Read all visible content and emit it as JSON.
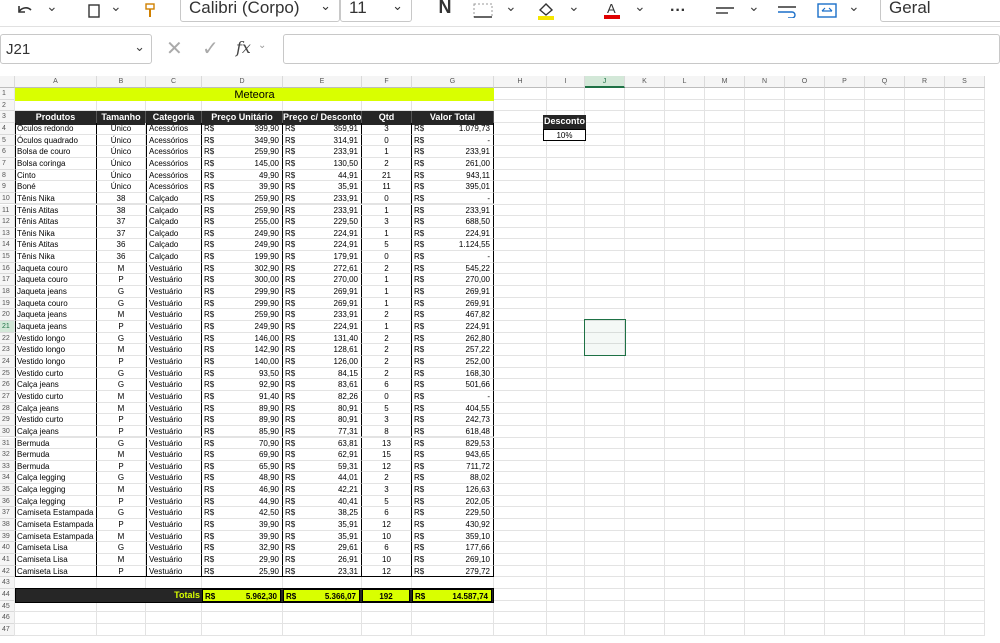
{
  "ribbon": {
    "font_name": "Calibri (Corpo)",
    "font_size": "11",
    "bold_glyph": "N",
    "number_format": "Geral",
    "more_glyph": "···",
    "fill_color": "#f5e600",
    "font_color": "#e00000"
  },
  "formula_bar": {
    "name_box": "J21",
    "fx_label": "fx",
    "formula": ""
  },
  "columns": [
    "A",
    "B",
    "C",
    "D",
    "E",
    "F",
    "G",
    "H",
    "I",
    "J",
    "K",
    "L",
    "M",
    "N",
    "O",
    "P",
    "Q",
    "R",
    "S"
  ],
  "title": "Meteora",
  "headers": [
    "Produtos",
    "Tamanho",
    "Categoria",
    "Preço Unitário",
    "Preço c/ Desconto",
    "Qtd",
    "Valor Total"
  ],
  "currency": "R$",
  "rows": [
    [
      "Óculos redondo",
      "Único",
      "Acessórios",
      "399,90",
      "359,91",
      "3",
      "1.079,73"
    ],
    [
      "Óculos quadrado",
      "Único",
      "Acessórios",
      "349,90",
      "314,91",
      "0",
      "-"
    ],
    [
      "Bolsa de couro",
      "Único",
      "Acessórios",
      "259,90",
      "233,91",
      "1",
      "233,91"
    ],
    [
      "Bolsa coringa",
      "Único",
      "Acessórios",
      "145,00",
      "130,50",
      "2",
      "261,00"
    ],
    [
      "Cinto",
      "Único",
      "Acessórios",
      "49,90",
      "44,91",
      "21",
      "943,11"
    ],
    [
      "Boné",
      "Único",
      "Acessórios",
      "39,90",
      "35,91",
      "11",
      "395,01"
    ],
    [
      "Tênis Nika",
      "38",
      "Calçado",
      "259,90",
      "233,91",
      "0",
      "-"
    ],
    [
      "Tênis Atitas",
      "38",
      "Calçado",
      "259,90",
      "233,91",
      "1",
      "233,91"
    ],
    [
      "Tênis Atitas",
      "37",
      "Calçado",
      "255,00",
      "229,50",
      "3",
      "688,50"
    ],
    [
      "Tênis Nika",
      "37",
      "Calçado",
      "249,90",
      "224,91",
      "1",
      "224,91"
    ],
    [
      "Tênis Atitas",
      "36",
      "Calçado",
      "249,90",
      "224,91",
      "5",
      "1.124,55"
    ],
    [
      "Tênis Nika",
      "36",
      "Calçado",
      "199,90",
      "179,91",
      "0",
      "-"
    ],
    [
      "Jaqueta couro",
      "M",
      "Vestuário",
      "302,90",
      "272,61",
      "2",
      "545,22"
    ],
    [
      "Jaqueta couro",
      "P",
      "Vestuário",
      "300,00",
      "270,00",
      "1",
      "270,00"
    ],
    [
      "Jaqueta jeans",
      "G",
      "Vestuário",
      "299,90",
      "269,91",
      "1",
      "269,91"
    ],
    [
      "Jaqueta couro",
      "G",
      "Vestuário",
      "299,90",
      "269,91",
      "1",
      "269,91"
    ],
    [
      "Jaqueta jeans",
      "M",
      "Vestuário",
      "259,90",
      "233,91",
      "2",
      "467,82"
    ],
    [
      "Jaqueta jeans",
      "P",
      "Vestuário",
      "249,90",
      "224,91",
      "1",
      "224,91"
    ],
    [
      "Vestido longo",
      "G",
      "Vestuário",
      "146,00",
      "131,40",
      "2",
      "262,80"
    ],
    [
      "Vestido longo",
      "M",
      "Vestuário",
      "142,90",
      "128,61",
      "2",
      "257,22"
    ],
    [
      "Vestido longo",
      "P",
      "Vestuário",
      "140,00",
      "126,00",
      "2",
      "252,00"
    ],
    [
      "Vestido curto",
      "G",
      "Vestuário",
      "93,50",
      "84,15",
      "2",
      "168,30"
    ],
    [
      "Calça jeans",
      "G",
      "Vestuário",
      "92,90",
      "83,61",
      "6",
      "501,66"
    ],
    [
      "Vestido curto",
      "M",
      "Vestuário",
      "91,40",
      "82,26",
      "0",
      "-"
    ],
    [
      "Calça jeans",
      "M",
      "Vestuário",
      "89,90",
      "80,91",
      "5",
      "404,55"
    ],
    [
      "Vestido curto",
      "P",
      "Vestuário",
      "89,90",
      "80,91",
      "3",
      "242,73"
    ],
    [
      "Calça jeans",
      "P",
      "Vestuário",
      "85,90",
      "77,31",
      "8",
      "618,48"
    ],
    [
      "Bermuda",
      "G",
      "Vestuário",
      "70,90",
      "63,81",
      "13",
      "829,53"
    ],
    [
      "Bermuda",
      "M",
      "Vestuário",
      "69,90",
      "62,91",
      "15",
      "943,65"
    ],
    [
      "Bermuda",
      "P",
      "Vestuário",
      "65,90",
      "59,31",
      "12",
      "711,72"
    ],
    [
      "Calça legging",
      "G",
      "Vestuário",
      "48,90",
      "44,01",
      "2",
      "88,02"
    ],
    [
      "Calça legging",
      "M",
      "Vestuário",
      "46,90",
      "42,21",
      "3",
      "126,63"
    ],
    [
      "Calça legging",
      "P",
      "Vestuário",
      "44,90",
      "40,41",
      "5",
      "202,05"
    ],
    [
      "Camiseta Estampada",
      "G",
      "Vestuário",
      "42,50",
      "38,25",
      "6",
      "229,50"
    ],
    [
      "Camiseta Estampada",
      "P",
      "Vestuário",
      "39,90",
      "35,91",
      "12",
      "430,92"
    ],
    [
      "Camiseta Estampada",
      "M",
      "Vestuário",
      "39,90",
      "35,91",
      "10",
      "359,10"
    ],
    [
      "Camiseta Lisa",
      "G",
      "Vestuário",
      "32,90",
      "29,61",
      "6",
      "177,66"
    ],
    [
      "Camiseta Lisa",
      "M",
      "Vestuário",
      "29,90",
      "26,91",
      "10",
      "269,10"
    ],
    [
      "Camiseta Lisa",
      "P",
      "Vestuário",
      "25,90",
      "23,31",
      "12",
      "279,72"
    ]
  ],
  "totals": {
    "label": "Totals",
    "preco_unitario": "5.962,30",
    "preco_desconto": "5.366,07",
    "qtd": "192",
    "valor_total": "14.587,74"
  },
  "discount": {
    "header": "Desconto",
    "value": "10%"
  },
  "selected_cell": "J21"
}
